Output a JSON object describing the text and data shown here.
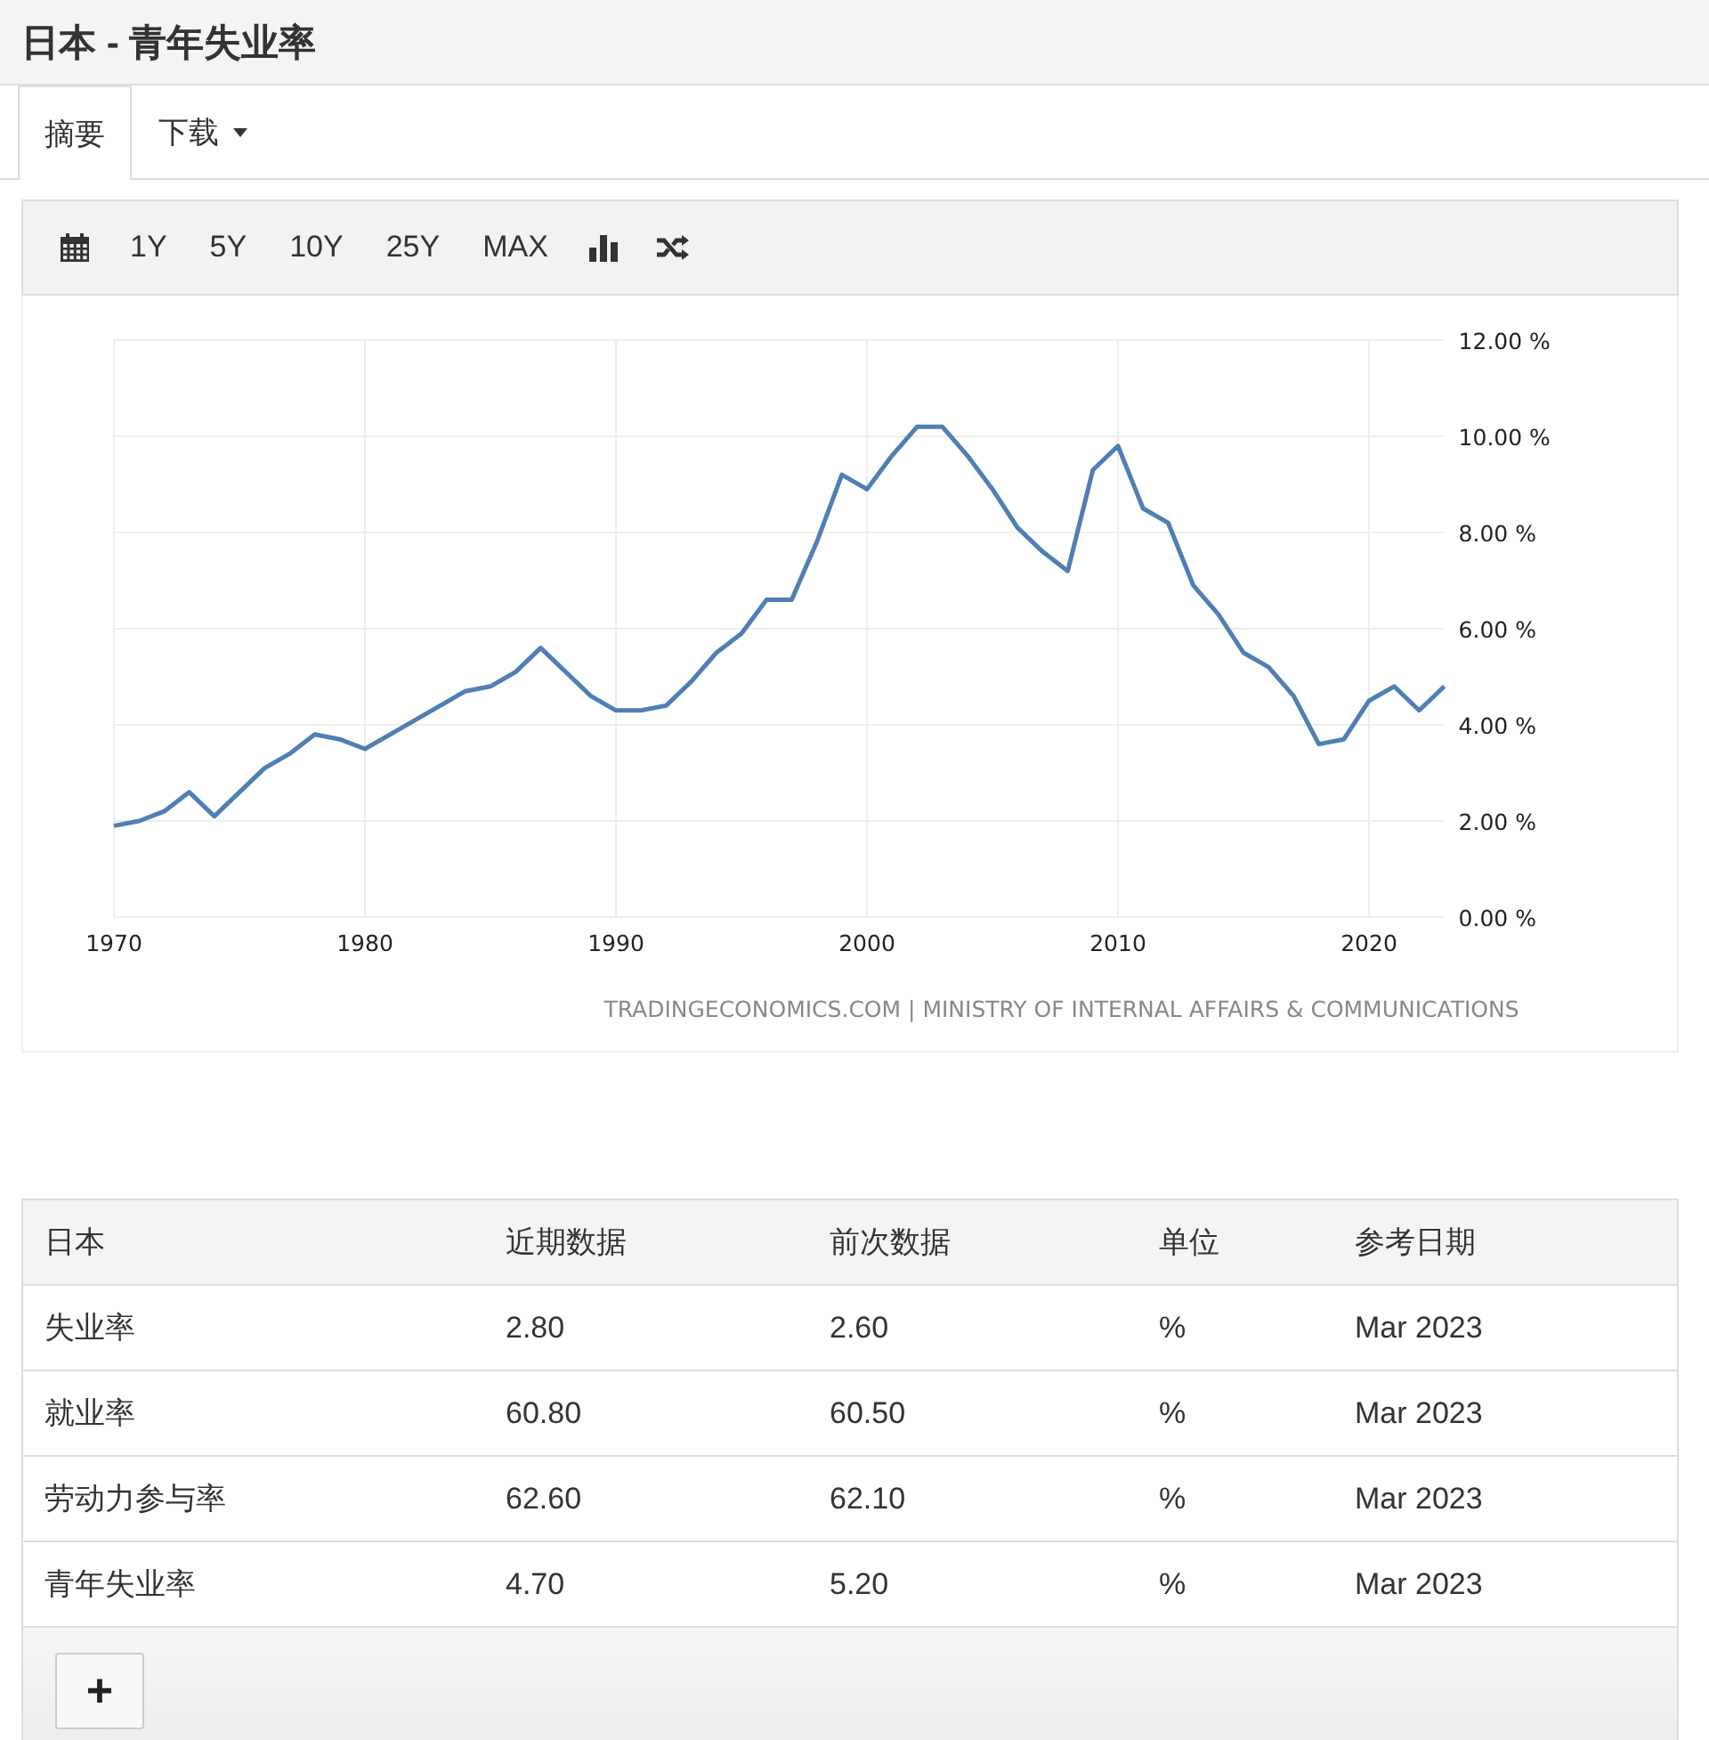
{
  "title": "日本 - 青年失业率",
  "tabs": [
    {
      "label": "摘要",
      "selected": true,
      "kind": "tab"
    },
    {
      "label": "下载",
      "selected": false,
      "kind": "dropdown"
    }
  ],
  "toolbar": {
    "ranges": [
      "1Y",
      "5Y",
      "10Y",
      "25Y",
      "MAX"
    ]
  },
  "chart": {
    "source": "TRADINGECONOMICS.COM | MINISTRY OF INTERNAL AFFAIRS & COMMUNICATIONS",
    "chart_data": {
      "type": "line",
      "x": [
        1970,
        1971,
        1972,
        1973,
        1974,
        1975,
        1976,
        1977,
        1978,
        1979,
        1980,
        1981,
        1982,
        1983,
        1984,
        1985,
        1986,
        1987,
        1988,
        1989,
        1990,
        1991,
        1992,
        1993,
        1994,
        1995,
        1996,
        1997,
        1998,
        1999,
        2000,
        2001,
        2002,
        2003,
        2004,
        2005,
        2006,
        2007,
        2008,
        2009,
        2010,
        2011,
        2012,
        2013,
        2014,
        2015,
        2016,
        2017,
        2018,
        2019,
        2020,
        2021,
        2022,
        2023
      ],
      "grid": true,
      "series": [
        {
          "color": "#4f7fb3",
          "values": [
            1.9,
            2.0,
            2.2,
            2.6,
            2.1,
            2.6,
            3.1,
            3.4,
            3.8,
            3.7,
            3.5,
            3.8,
            4.1,
            4.4,
            4.7,
            4.8,
            5.1,
            5.6,
            5.1,
            4.6,
            4.3,
            4.3,
            4.4,
            4.9,
            5.5,
            5.9,
            6.6,
            6.6,
            7.8,
            9.2,
            8.9,
            9.6,
            10.2,
            10.2,
            9.6,
            8.9,
            8.1,
            7.6,
            7.2,
            9.3,
            9.8,
            8.5,
            8.2,
            6.9,
            6.3,
            5.5,
            5.2,
            4.6,
            3.6,
            3.7,
            4.5,
            4.8,
            4.3,
            4.8
          ]
        }
      ],
      "xticks": [
        1970,
        1980,
        1990,
        2000,
        2010,
        2020
      ],
      "yticks": [
        {
          "value": 0,
          "label": "0.00 %"
        },
        {
          "value": 2,
          "label": "2.00 %"
        },
        {
          "value": 4,
          "label": "4.00 %"
        },
        {
          "value": 6,
          "label": "6.00 %"
        },
        {
          "value": 8,
          "label": "8.00 %"
        },
        {
          "value": 10,
          "label": "10.00 %"
        },
        {
          "value": 12,
          "label": "12.00 %"
        }
      ],
      "xlim": [
        1970,
        2023
      ],
      "ylim": [
        0,
        12
      ]
    }
  },
  "table": {
    "columns": [
      "日本",
      "近期数据",
      "前次数据",
      "单位",
      "参考日期"
    ],
    "rows": [
      [
        "失业率",
        "2.80",
        "2.60",
        "%",
        "Mar 2023"
      ],
      [
        "就业率",
        "60.80",
        "60.50",
        "%",
        "Mar 2023"
      ],
      [
        "劳动力参与率",
        "62.60",
        "62.10",
        "%",
        "Mar 2023"
      ],
      [
        "青年失业率",
        "4.70",
        "5.20",
        "%",
        "Mar 2023"
      ]
    ]
  },
  "add_button": "+"
}
